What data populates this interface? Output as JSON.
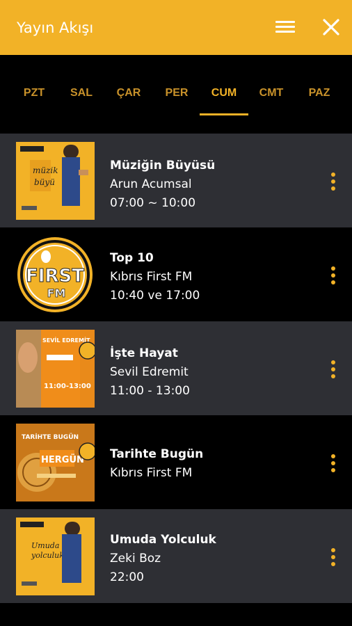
{
  "header": {
    "title": "Yayın Akışı"
  },
  "tabs": [
    "PZT",
    "SAL",
    "ÇAR",
    "PER",
    "CUM",
    "CMT",
    "PAZ"
  ],
  "active_tab": "CUM",
  "programs": [
    {
      "title": "Müziğin Büyüsü",
      "host": "Arun Acumsal",
      "time": "07:00 ~ 10:00"
    },
    {
      "title": "Top 10",
      "host": "Kıbrıs First FM",
      "time": "10:40 ve 17:00"
    },
    {
      "title": "İşte Hayat",
      "host": "Sevil Edremit",
      "time": "11:00 - 13:00"
    },
    {
      "title": "Tarihte Bugün",
      "host": "Kıbrıs First FM"
    },
    {
      "title": "Umuda Yolculuk",
      "host": "Zeki Boz",
      "time": "22:00"
    }
  ],
  "thumbs": {
    "logo_first": "FIRST",
    "logo_fm": "FM",
    "thumb3_name": "SEVİL EDREMİT",
    "thumb3_time": "11:00-13:00",
    "thumb4_top": "TARİHTE BUGÜN",
    "thumb4_main": "HERGÜN"
  },
  "colors": {
    "accent": "#f2b227",
    "row_dark": "#2e2f34",
    "background": "#000000"
  }
}
